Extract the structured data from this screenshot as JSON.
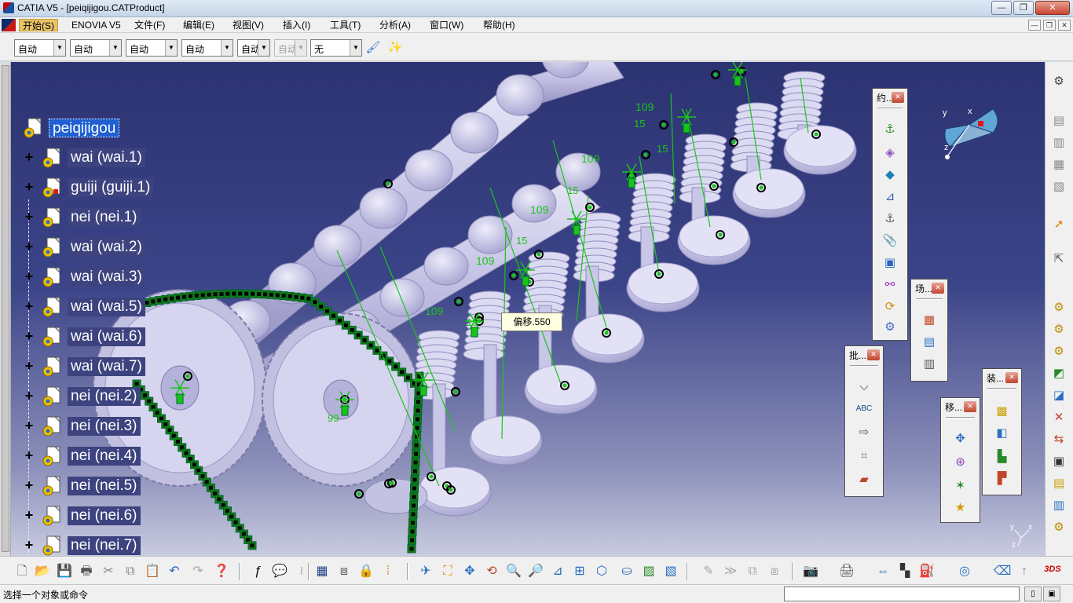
{
  "window": {
    "title": "CATIA V5 - [peiqijigou.CATProduct]",
    "controls": [
      "—",
      "❐",
      "✕"
    ]
  },
  "menubar": {
    "items": [
      "开始(S)",
      "ENOVIA V5",
      "文件(F)",
      "编辑(E)",
      "视图(V)",
      "插入(I)",
      "工具(T)",
      "分析(A)",
      "窗口(W)",
      "帮助(H)"
    ],
    "mdi_controls": [
      "—",
      "❐",
      "✕"
    ]
  },
  "combos": [
    {
      "value": "自动",
      "enabled": true
    },
    {
      "value": "自动",
      "enabled": true
    },
    {
      "value": "自动",
      "enabled": true
    },
    {
      "value": "自动",
      "enabled": true
    },
    {
      "value": "自动",
      "enabled": true
    },
    {
      "value": "自动",
      "enabled": false
    },
    {
      "value": "无",
      "enabled": true
    }
  ],
  "tree": {
    "root": "peiqijigou",
    "children": [
      "wai (wai.1)",
      "guiji (guiji.1)",
      "nei (nei.1)",
      "wai (wai.2)",
      "wai (wai.3)",
      "wai (wai.5)",
      "wai (wai.6)",
      "wai (wai.7)",
      "nei (nei.2)",
      "nei (nei.3)",
      "nei (nei.4)",
      "nei (nei.5)",
      "nei (nei.6)",
      "nei (nei.7)"
    ]
  },
  "viewport": {
    "tooltip": "偏移.550",
    "dimension_labels": [
      "109",
      "109",
      "109",
      "109",
      "109",
      "15",
      "15",
      "15",
      "15",
      "15",
      "99"
    ],
    "compass_axes": [
      "x",
      "y",
      "z"
    ],
    "mini_axes": [
      "y",
      "x",
      "z"
    ]
  },
  "floating_toolbars": [
    {
      "title": "约...",
      "buttons": [
        "fix-icon",
        "coincidence-icon",
        "contact-icon",
        "offset-icon",
        "angle-icon",
        "fix-together-icon",
        "quick-constraint-icon",
        "flexible-icon",
        "update-icon",
        "multi-constraint-icon"
      ]
    },
    {
      "title": "场...",
      "buttons": [
        "scene-create-icon",
        "scene-apply-icon",
        "scene-browser-icon"
      ]
    },
    {
      "title": "批...",
      "buttons": [
        "flag-note-icon",
        "text-annotation-icon",
        "3d-annotation-icon",
        "weld-icon",
        "measure-icon"
      ]
    },
    {
      "title": "移...",
      "buttons": [
        "manipulate-icon",
        "snap-icon",
        "explode-icon",
        "clash-stop-icon"
      ]
    },
    {
      "title": "装...",
      "buttons": [
        "existing-component-icon",
        "new-product-icon",
        "new-part-icon",
        "new-component-icon"
      ]
    }
  ],
  "statusbar": {
    "text": "选择一个对象或命令",
    "command_value": ""
  },
  "colors": {
    "accent": "#1f5fd1",
    "constraint_green": "#19c419",
    "part_lavender": "#c6c4e6"
  }
}
